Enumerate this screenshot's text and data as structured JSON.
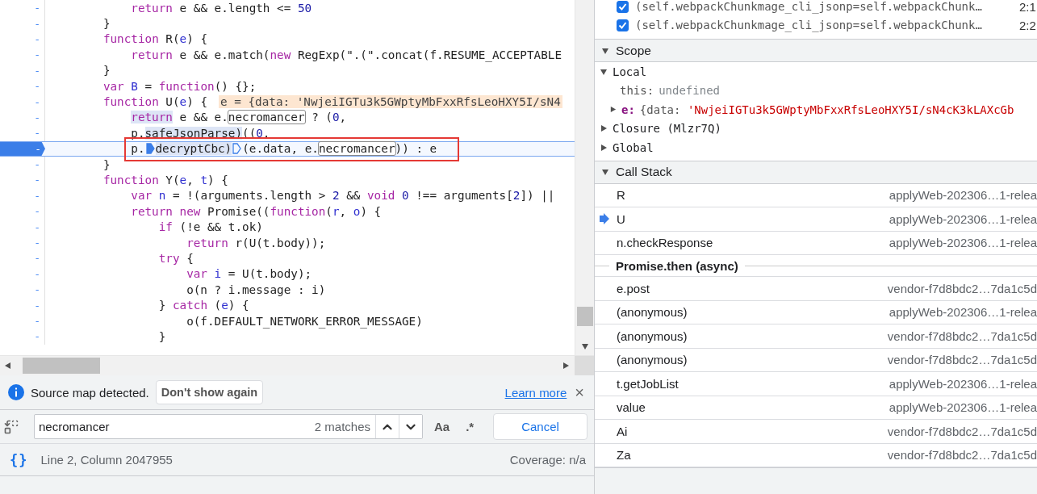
{
  "editor": {
    "lines": [
      {
        "gutter": "-",
        "current": false,
        "boxed": false,
        "tokens": [
          {
            "kind": "kw",
            "text": "            return"
          },
          {
            "kind": "p",
            "text": " e && e.length <= "
          },
          {
            "kind": "num",
            "text": "50"
          }
        ]
      },
      {
        "gutter": "-",
        "current": false,
        "boxed": false,
        "tokens": [
          {
            "kind": "p",
            "text": "        }"
          }
        ]
      },
      {
        "gutter": "-",
        "current": false,
        "boxed": false,
        "tokens": [
          {
            "kind": "kw",
            "text": "        function"
          },
          {
            "kind": "p",
            "text": " R("
          },
          {
            "kind": "def",
            "text": "e"
          },
          {
            "kind": "p",
            "text": ") {"
          }
        ]
      },
      {
        "gutter": "-",
        "current": false,
        "boxed": false,
        "tokens": [
          {
            "kind": "kw",
            "text": "            return"
          },
          {
            "kind": "p",
            "text": " e && e.match("
          },
          {
            "kind": "kw",
            "text": "new"
          },
          {
            "kind": "p",
            "text": " RegExp(\".(\".concat(f.RESUME_ACCEPTABLE"
          }
        ]
      },
      {
        "gutter": "-",
        "current": false,
        "boxed": false,
        "tokens": [
          {
            "kind": "p",
            "text": "        }"
          }
        ]
      },
      {
        "gutter": "-",
        "current": false,
        "boxed": false,
        "tokens": [
          {
            "kind": "kw",
            "text": "        var"
          },
          {
            "kind": "def",
            "text": " B"
          },
          {
            "kind": "p",
            "text": " = "
          },
          {
            "kind": "kw",
            "text": "function"
          },
          {
            "kind": "p",
            "text": "() {};"
          }
        ]
      },
      {
        "gutter": "-",
        "current": false,
        "boxed": false,
        "tokens": [
          {
            "kind": "kw",
            "text": "        function"
          },
          {
            "kind": "p",
            "text": " U("
          },
          {
            "kind": "def",
            "text": "e"
          },
          {
            "kind": "p",
            "text": ") {"
          },
          {
            "kind": "inline",
            "text": "e = {data: 'NwjeiIGTu3k5GWptyMbFxxRfsLeoHXY5I/sN4"
          }
        ]
      },
      {
        "gutter": "-",
        "current": false,
        "boxed": false,
        "tokens": [
          {
            "kind": "evalkw",
            "text": "            return"
          },
          {
            "kind": "p",
            "text": " e && e."
          },
          {
            "kind": "match",
            "text": "necromancer"
          },
          {
            "kind": "p",
            "text": " ? ("
          },
          {
            "kind": "num",
            "text": "0"
          },
          {
            "kind": "p",
            "text": ","
          }
        ]
      },
      {
        "gutter": "-",
        "current": false,
        "boxed": false,
        "tokens": [
          {
            "kind": "p",
            "text": "            p."
          },
          {
            "kind": "eval",
            "text": "safeJsonParse)"
          },
          {
            "kind": "p",
            "text": "(("
          },
          {
            "kind": "num",
            "text": "0"
          },
          {
            "kind": "p",
            "text": ","
          }
        ]
      },
      {
        "gutter": "-",
        "current": true,
        "boxed": true,
        "tokens": [
          {
            "kind": "p",
            "text": "            p."
          },
          {
            "kind": "step",
            "filled": true
          },
          {
            "kind": "eval",
            "text": "decryptCbc)"
          },
          {
            "kind": "step",
            "filled": false
          },
          {
            "kind": "p",
            "text": "(e.data, e."
          },
          {
            "kind": "match",
            "text": "necromancer"
          },
          {
            "kind": "p",
            "text": ")) : e"
          }
        ]
      },
      {
        "gutter": "-",
        "current": false,
        "boxed": false,
        "tokens": [
          {
            "kind": "p",
            "text": "        }"
          }
        ]
      },
      {
        "gutter": "-",
        "current": false,
        "boxed": false,
        "tokens": [
          {
            "kind": "kw",
            "text": "        function"
          },
          {
            "kind": "p",
            "text": " Y("
          },
          {
            "kind": "def",
            "text": "e"
          },
          {
            "kind": "p",
            "text": ", "
          },
          {
            "kind": "def",
            "text": "t"
          },
          {
            "kind": "p",
            "text": ") {"
          }
        ]
      },
      {
        "gutter": "-",
        "current": false,
        "boxed": false,
        "tokens": [
          {
            "kind": "kw",
            "text": "            var"
          },
          {
            "kind": "def",
            "text": " n"
          },
          {
            "kind": "p",
            "text": " = !(arguments.length > "
          },
          {
            "kind": "num",
            "text": "2"
          },
          {
            "kind": "p",
            "text": " && "
          },
          {
            "kind": "kw",
            "text": "void"
          },
          {
            "kind": "num",
            "text": " 0"
          },
          {
            "kind": "p",
            "text": " !== arguments["
          },
          {
            "kind": "num",
            "text": "2"
          },
          {
            "kind": "p",
            "text": "]) ||"
          }
        ]
      },
      {
        "gutter": "-",
        "current": false,
        "boxed": false,
        "tokens": [
          {
            "kind": "kw",
            "text": "            return"
          },
          {
            "kind": "kw",
            "text": " new"
          },
          {
            "kind": "p",
            "text": " Promise(("
          },
          {
            "kind": "kw",
            "text": "function"
          },
          {
            "kind": "p",
            "text": "("
          },
          {
            "kind": "def",
            "text": "r"
          },
          {
            "kind": "p",
            "text": ", "
          },
          {
            "kind": "def",
            "text": "o"
          },
          {
            "kind": "p",
            "text": ") {"
          }
        ]
      },
      {
        "gutter": "-",
        "current": false,
        "boxed": false,
        "tokens": [
          {
            "kind": "kw",
            "text": "                if"
          },
          {
            "kind": "p",
            "text": " (!e && t.ok)"
          }
        ]
      },
      {
        "gutter": "-",
        "current": false,
        "boxed": false,
        "tokens": [
          {
            "kind": "kw",
            "text": "                    return"
          },
          {
            "kind": "p",
            "text": " r(U(t.body));"
          }
        ]
      },
      {
        "gutter": "-",
        "current": false,
        "boxed": false,
        "tokens": [
          {
            "kind": "kw",
            "text": "                try"
          },
          {
            "kind": "p",
            "text": " {"
          }
        ]
      },
      {
        "gutter": "-",
        "current": false,
        "boxed": false,
        "tokens": [
          {
            "kind": "kw",
            "text": "                    var"
          },
          {
            "kind": "def",
            "text": " i"
          },
          {
            "kind": "p",
            "text": " = U(t.body);"
          }
        ]
      },
      {
        "gutter": "-",
        "current": false,
        "boxed": false,
        "tokens": [
          {
            "kind": "p",
            "text": "                    o(n ? i.message : i)"
          }
        ]
      },
      {
        "gutter": "-",
        "current": false,
        "boxed": false,
        "tokens": [
          {
            "kind": "p",
            "text": "                }"
          },
          {
            "kind": "kw",
            "text": " catch"
          },
          {
            "kind": "p",
            "text": " ("
          },
          {
            "kind": "def",
            "text": "e"
          },
          {
            "kind": "p",
            "text": ") {"
          }
        ]
      },
      {
        "gutter": "-",
        "current": false,
        "boxed": false,
        "tokens": [
          {
            "kind": "p",
            "text": "                    o(f.DEFAULT_NETWORK_ERROR_MESSAGE)"
          }
        ]
      },
      {
        "gutter": "-",
        "current": false,
        "boxed": false,
        "tokens": [
          {
            "kind": "p",
            "text": "                }"
          }
        ]
      }
    ]
  },
  "infobar": {
    "message": "Source map detected.",
    "button": "Don't show again",
    "link": "Learn more",
    "close": "×"
  },
  "search": {
    "value": "necromancer",
    "matches": "2 matches",
    "case_label": "Aa",
    "regex_label": ".*",
    "cancel": "Cancel"
  },
  "status_bar": {
    "pretty_print": "{}",
    "position": "Line 2, Column 2047955",
    "coverage": "Coverage: n/a"
  },
  "breakpoints": [
    {
      "checked": true,
      "code": "(self.webpackChunkmage_cli_jsonp=self.webpackChunk…",
      "location": "2:1"
    },
    {
      "checked": true,
      "code": "(self.webpackChunkmage_cli_jsonp=self.webpackChunk…",
      "location": "2:2"
    }
  ],
  "scope": {
    "title": "Scope",
    "expanded": true,
    "items": [
      {
        "label": "Local",
        "expanded": true,
        "children": [
          {
            "kind": "undefined",
            "key": "this:",
            "value": "undefined"
          },
          {
            "kind": "object",
            "key": "e:",
            "value_prefix": "{data: ",
            "value": "'NwjeiIGTu3k5GWptyMbFxxRfsLeoHXY5I/sN4cK3kLAXcGb",
            "expanded": false
          }
        ]
      },
      {
        "label": "Closure (Mlzr7Q)",
        "expanded": false
      },
      {
        "label": "Global",
        "expanded": false
      }
    ]
  },
  "call_stack": {
    "title": "Call Stack",
    "expanded": true,
    "frames": [
      {
        "kind": "frame",
        "name": "R",
        "location": "applyWeb-202306…1-relea",
        "current": false
      },
      {
        "kind": "frame",
        "name": "U",
        "location": "applyWeb-202306…1-relea",
        "current": true
      },
      {
        "kind": "frame",
        "name": "n.checkResponse",
        "location": "applyWeb-202306…1-relea",
        "current": false
      },
      {
        "kind": "async",
        "name": "Promise.then (async)"
      },
      {
        "kind": "frame",
        "name": "e.post",
        "location": "vendor-f7d8bdc2…7da1c5d",
        "current": false
      },
      {
        "kind": "frame",
        "name": "(anonymous)",
        "location": "applyWeb-202306…1-relea",
        "current": false
      },
      {
        "kind": "frame",
        "name": "(anonymous)",
        "location": "vendor-f7d8bdc2…7da1c5d",
        "current": false
      },
      {
        "kind": "frame",
        "name": "(anonymous)",
        "location": "vendor-f7d8bdc2…7da1c5d",
        "current": false
      },
      {
        "kind": "frame",
        "name": "t.getJobList",
        "location": "applyWeb-202306…1-relea",
        "current": false
      },
      {
        "kind": "frame",
        "name": "value",
        "location": "applyWeb-202306…1-relea",
        "current": false
      },
      {
        "kind": "frame",
        "name": "Ai",
        "location": "vendor-f7d8bdc2…7da1c5d",
        "current": false
      },
      {
        "kind": "frame",
        "name": "Za",
        "location": "vendor-f7d8bdc2…7da1c5d",
        "current": false
      }
    ]
  }
}
